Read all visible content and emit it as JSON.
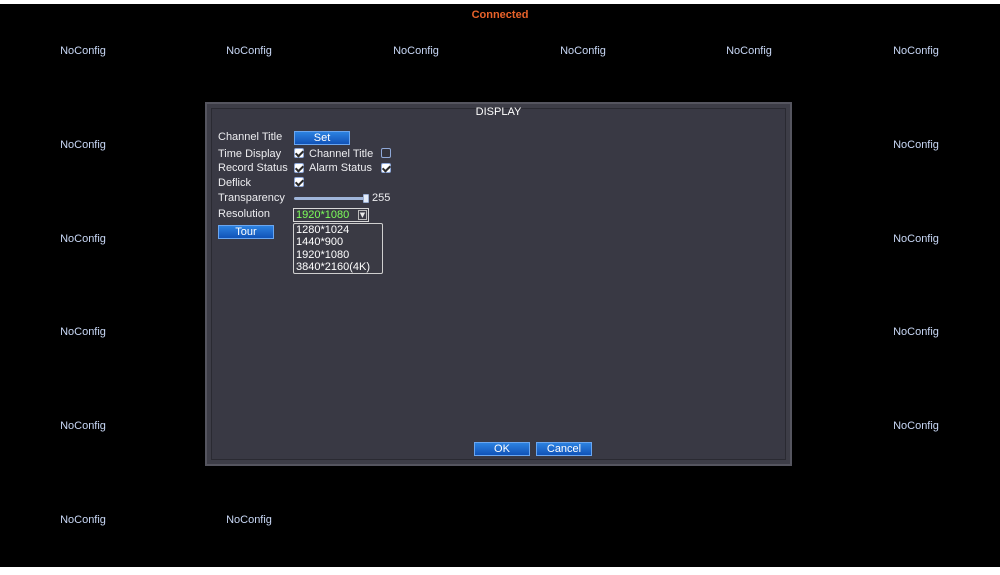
{
  "status": "Connected",
  "channels": {
    "label": "NoConfig"
  },
  "dialog": {
    "title": "DISPLAY",
    "channel_title_label": "Channel Title",
    "set_button": "Set",
    "time_display_label": "Time Display",
    "time_display_checked": true,
    "channel_title_check_label": "Channel Title",
    "channel_title_checked": false,
    "record_status_label": "Record Status",
    "record_status_checked": true,
    "alarm_status_label": "Alarm Status",
    "alarm_status_checked": true,
    "deflick_label": "Deflick",
    "deflick_checked": true,
    "transparency_label": "Transparency",
    "transparency_value": "255",
    "resolution_label": "Resolution",
    "resolution_selected": "1920*1080",
    "resolution_options": [
      "1280*1024",
      "1440*900",
      "1920*1080",
      "3840*2160(4K)"
    ],
    "tour_button": "Tour",
    "ok_button": "OK",
    "cancel_button": "Cancel"
  },
  "colors": {
    "status": "#e8622a",
    "channel_label": "#c8d7f5",
    "button_blue": "#1a6ad0",
    "selected_value": "#7dff5a"
  }
}
